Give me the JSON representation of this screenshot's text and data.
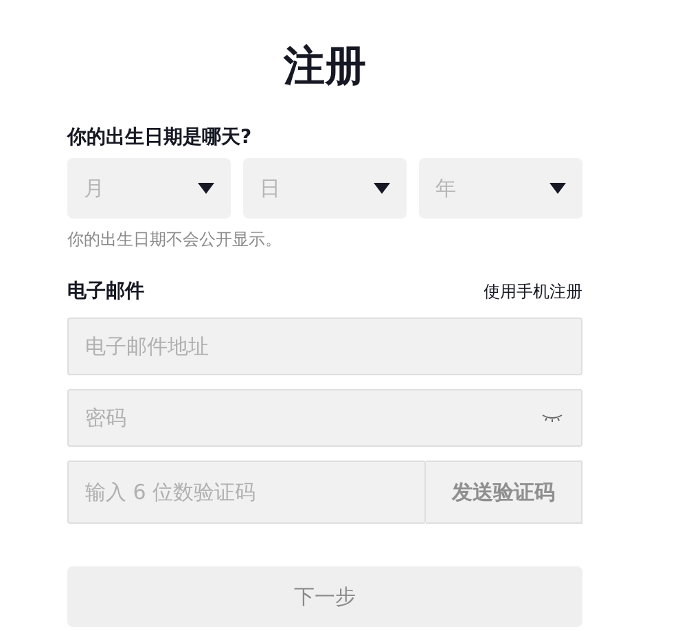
{
  "title": "注册",
  "birthday": {
    "label": "你的出生日期是哪天?",
    "selects": [
      {
        "placeholder": "月"
      },
      {
        "placeholder": "日"
      },
      {
        "placeholder": "年"
      }
    ],
    "hint": "你的出生日期不会公开显示。"
  },
  "email": {
    "label": "电子邮件",
    "switch_link": "使用手机注册",
    "address_placeholder": "电子邮件地址",
    "password_placeholder": "密码",
    "code_placeholder": "输入 6 位数验证码",
    "send_code_button": "发送验证码"
  },
  "next_button": {
    "label": "下一步",
    "disabled": true
  }
}
